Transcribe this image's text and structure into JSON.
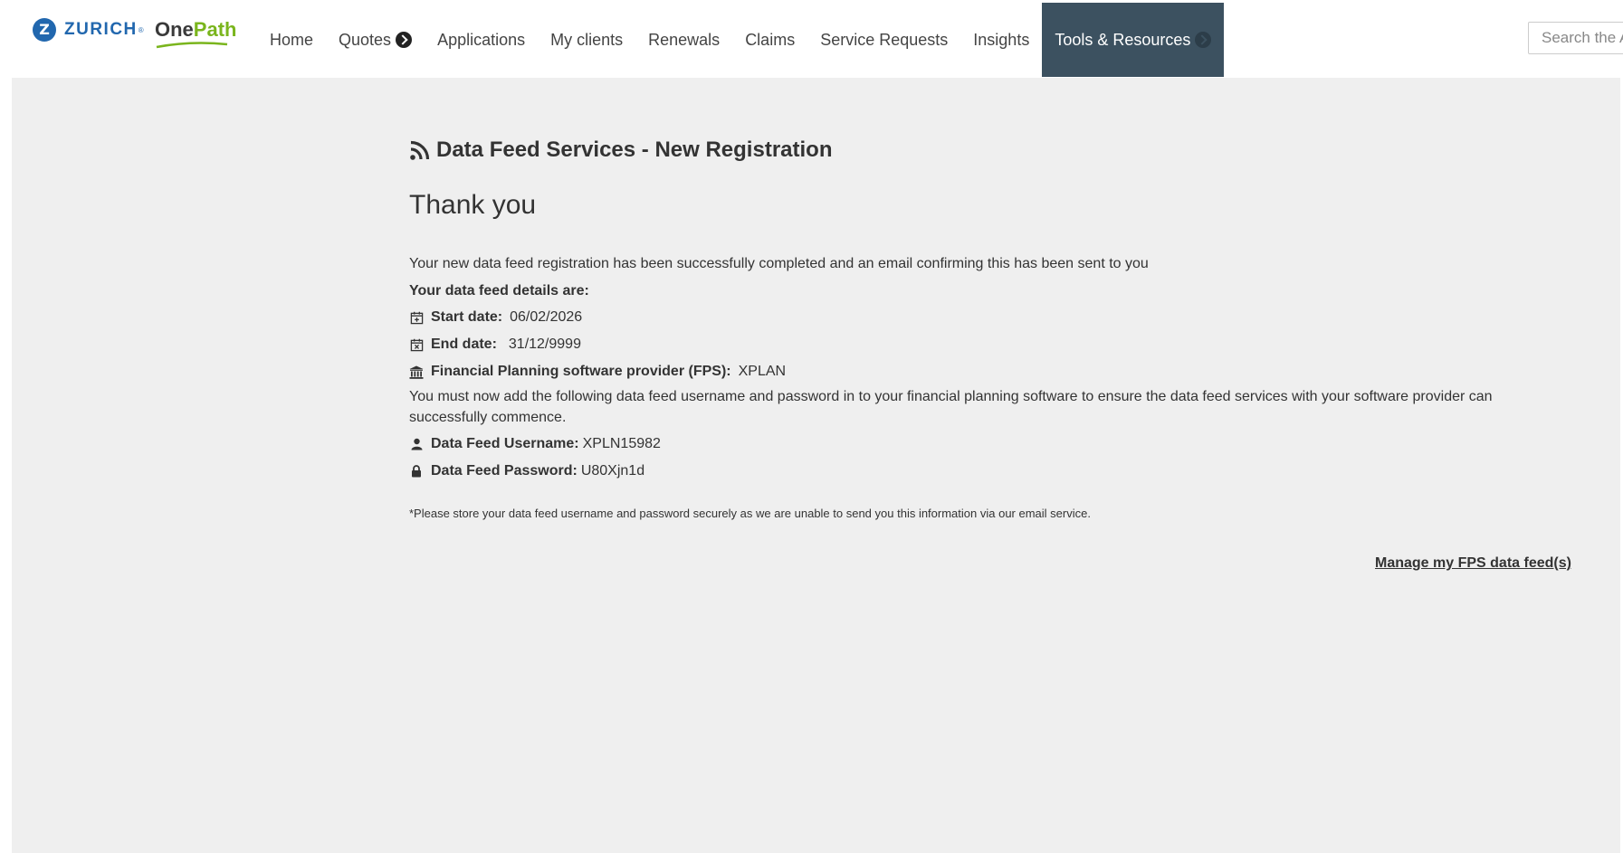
{
  "header": {
    "zurich_logo": {
      "mark": "Z",
      "text": "ZURICH",
      "reg": "®"
    },
    "onepath_logo": {
      "one": "One",
      "path": "Path"
    },
    "nav": [
      {
        "label": "Home",
        "has_chevron": false,
        "active": false
      },
      {
        "label": "Quotes",
        "has_chevron": true,
        "active": false
      },
      {
        "label": "Applications",
        "has_chevron": false,
        "active": false
      },
      {
        "label": "My clients",
        "has_chevron": false,
        "active": false
      },
      {
        "label": "Renewals",
        "has_chevron": false,
        "active": false
      },
      {
        "label": "Claims",
        "has_chevron": false,
        "active": false
      },
      {
        "label": "Service Requests",
        "has_chevron": false,
        "active": false
      },
      {
        "label": "Insights",
        "has_chevron": false,
        "active": false
      },
      {
        "label": "Tools & Resources",
        "has_chevron": true,
        "active": true
      }
    ],
    "search_placeholder": "Search the A"
  },
  "main": {
    "title": "Data Feed Services - New Registration",
    "heading": "Thank you",
    "confirmation": "Your new data feed registration has been successfully completed and an email confirming this has been sent to you",
    "details_heading": "Your data feed details are:",
    "start_date": {
      "label": "Start date:",
      "value": "06/02/2026",
      "icon": "calendar-plus-icon"
    },
    "end_date": {
      "label": "End date:",
      "value": "31/12/9999",
      "icon": "calendar-x-icon"
    },
    "fps": {
      "label": "Financial Planning software provider (FPS):",
      "value": "XPLAN",
      "icon": "bank-icon"
    },
    "instructions": "You must now add the following data feed username and password in to your financial planning software to ensure the data feed services with your software provider can successfully commence.",
    "username": {
      "label": "Data Feed Username:",
      "value": "XPLN15982",
      "icon": "user-icon"
    },
    "password": {
      "label": "Data Feed Password:",
      "value": "U80Xjn1d",
      "icon": "lock-icon"
    },
    "note": "*Please store your data feed username and password securely as we are unable to send you this information via our email service.",
    "manage_link": "Manage my FPS data feed(s)"
  },
  "colors": {
    "zurich_blue": "#2167ae",
    "onepath_green": "#7ab51d",
    "nav_active_bg": "#3c5160",
    "content_bg": "#efefef"
  }
}
